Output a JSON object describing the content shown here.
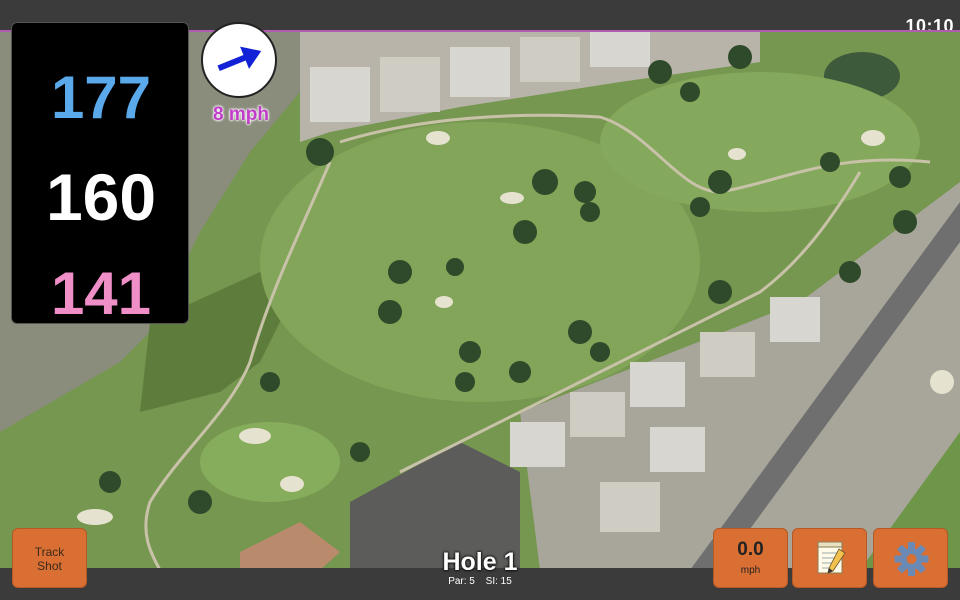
{
  "status": {
    "clock": "10:10"
  },
  "yardage": {
    "back": "177",
    "center": "160",
    "front": "141"
  },
  "wind": {
    "speed_label": "8 mph",
    "icon": "wind-direction-arrow-icon"
  },
  "hole": {
    "title": "Hole 1",
    "par": "Par: 5",
    "stroke_index": "SI: 15"
  },
  "buttons": {
    "track_shot": {
      "line1": "Track",
      "line2": "Shot"
    },
    "speed": {
      "value": "0.0",
      "unit": "mph"
    },
    "notes_icon": "notepad-icon",
    "settings_icon": "gear-icon"
  },
  "colors": {
    "back_yardage": "#5aa9ea",
    "center_yardage": "#ffffff",
    "front_yardage": "#f08ec8",
    "button": "#d96f33",
    "wind_label": "#c13cc8"
  }
}
